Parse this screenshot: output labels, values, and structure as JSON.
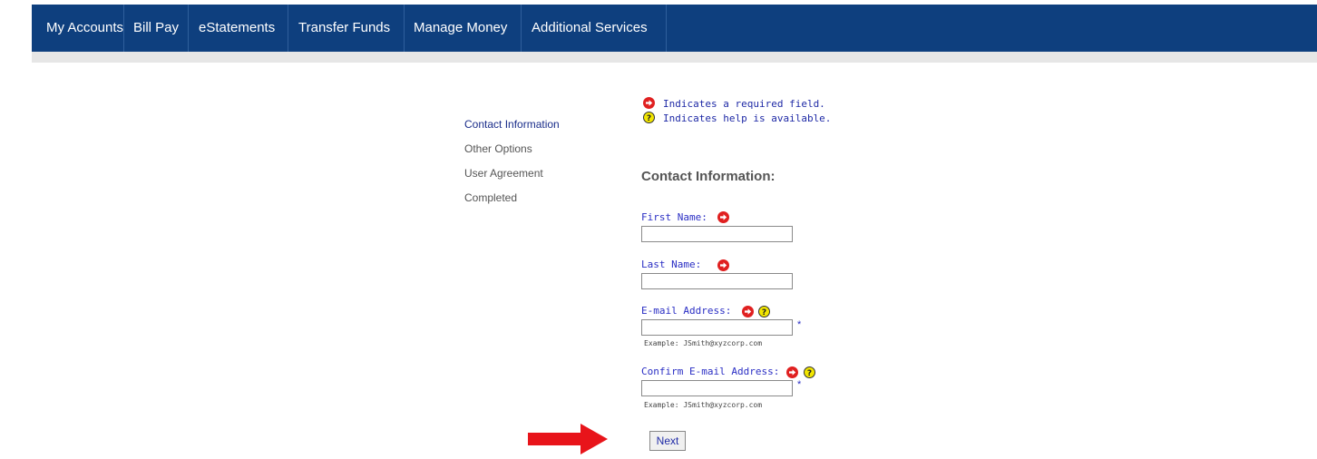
{
  "nav": {
    "items": [
      {
        "label": "My Accounts"
      },
      {
        "label": "Bill Pay"
      },
      {
        "label": "eStatements"
      },
      {
        "label": "Transfer Funds"
      },
      {
        "label": "Manage Money"
      },
      {
        "label": "Additional Services"
      }
    ]
  },
  "steps": [
    {
      "label": "Contact Information",
      "active": true
    },
    {
      "label": "Other Options"
    },
    {
      "label": "User Agreement"
    },
    {
      "label": "Completed"
    }
  ],
  "legend": {
    "required": "Indicates a required field.",
    "help": "Indicates help is available."
  },
  "form": {
    "title": "Contact Information:",
    "first_name": {
      "label": "First Name:",
      "value": ""
    },
    "last_name": {
      "label": "Last Name:",
      "value": ""
    },
    "email": {
      "label": "E-mail Address:",
      "value": "",
      "asterisk": "*",
      "example": "Example: JSmith@xyzcorp.com"
    },
    "confirm_email": {
      "label": "Confirm E-mail Address:",
      "value": "",
      "asterisk": "*",
      "example": "Example: JSmith@xyzcorp.com"
    },
    "next_label": "Next"
  },
  "colors": {
    "nav_bg": "#0e3f7e",
    "required_icon": "#e02020",
    "help_icon": "#f2e600",
    "arrow": "#e8141a"
  },
  "icons": {
    "required": "required-arrow-icon",
    "help": "help-question-icon",
    "pointer": "red-pointer-arrow-icon"
  }
}
